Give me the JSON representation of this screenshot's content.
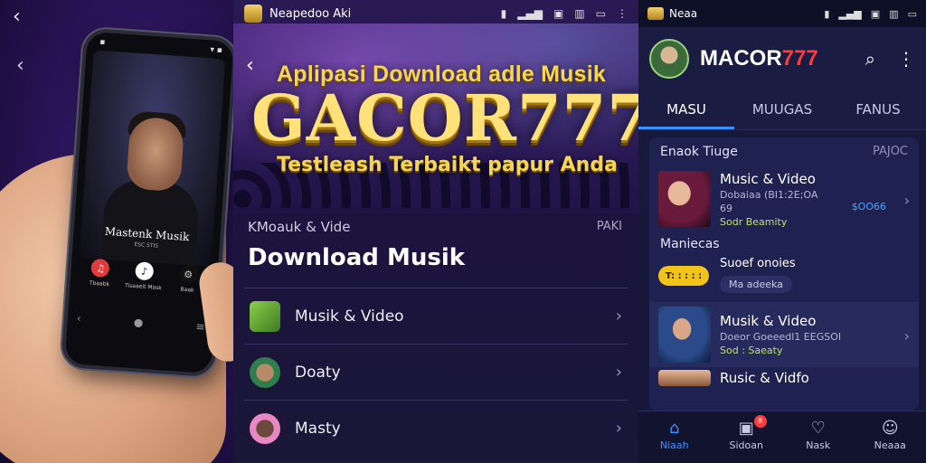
{
  "left": {
    "back_icon": "‹",
    "phone": {
      "artist_title": "Mastenk Musik",
      "artist_sub": "ESC STIS",
      "icons": [
        {
          "name": "music-red",
          "label": "Tbaabk",
          "glyph": "♫",
          "color": "#e33b3b"
        },
        {
          "name": "music-white",
          "label": "Tisaaeit Mask",
          "glyph": "♪",
          "color": "#ffffff"
        },
        {
          "name": "gear",
          "label": "Baak",
          "glyph": "⚙",
          "color": "#cccccc"
        }
      ]
    }
  },
  "middle": {
    "status": {
      "app_title": "Neapedoo Aki"
    },
    "headline": "Aplipasi Download adle Musik",
    "brand": "GACOR777",
    "tagline": "Testleash Terbaikt papur Anda",
    "section_small": "KMoauk & Vide",
    "section_right": "PAKI",
    "title": "Download Musik",
    "items": [
      {
        "label": "Musik & Video",
        "color": "#6fae3a"
      },
      {
        "label": "Doaty",
        "color": "#2f7e4c"
      },
      {
        "label": "Masty",
        "color": "#e888c2"
      }
    ]
  },
  "right": {
    "status": {
      "app_title": "Neaa"
    },
    "brand_white": "MACOR",
    "brand_red": "777",
    "tabs": [
      {
        "label": "MASU",
        "active": true
      },
      {
        "label": "MUUGAS",
        "active": false
      },
      {
        "label": "FANUS",
        "active": false
      }
    ],
    "card": {
      "head_left": "Enaok Tiuge",
      "head_right": "PAJOC",
      "item1": {
        "title": "Music & Video",
        "sub1": "Dobaiaa (BI1:2E;OA",
        "sub2": "69",
        "green": "Sodr Beamity",
        "price": "$OO66"
      },
      "subhead": "Maniecas",
      "promo": {
        "pill": "T: : : : :",
        "title": "Suoef onoies",
        "chip": "Ma adeeka"
      },
      "item2": {
        "title": "Musik & Video",
        "sub1": "Doeor Goeeedl1 EEGSOI",
        "green": "Sod : Saeaty"
      },
      "item3": {
        "title": "Rusic & Vidfo"
      }
    },
    "nav": [
      {
        "label": "Niaah",
        "icon": "⌂",
        "active": true
      },
      {
        "label": "Sidoan",
        "icon": "▣",
        "badge": "8",
        "active": false
      },
      {
        "label": "Nask",
        "icon": "♡",
        "active": false
      },
      {
        "label": "Neaaa",
        "icon": "☺",
        "active": false
      }
    ]
  }
}
